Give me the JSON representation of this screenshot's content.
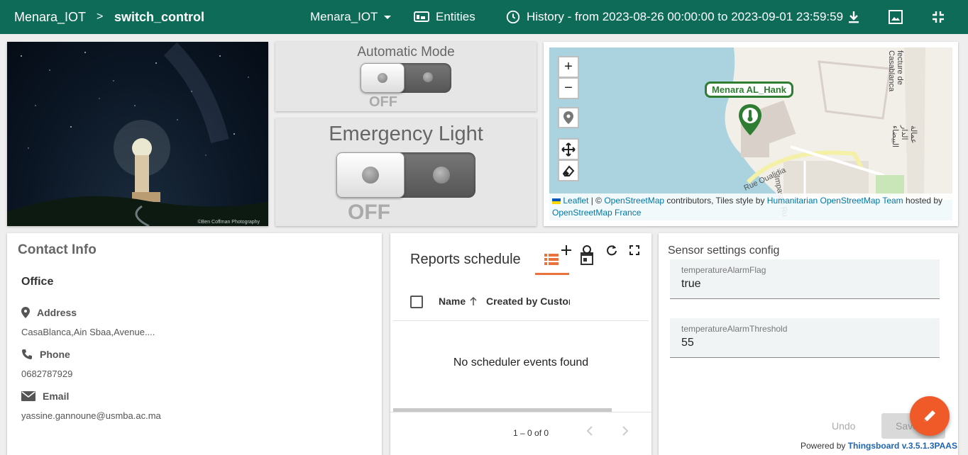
{
  "header": {
    "breadcrumb_root": "Menara_IOT",
    "breadcrumb_sep": ">",
    "breadcrumb_current": "switch_control",
    "entity_selector": "Menara_IOT",
    "entities_label": "Entities",
    "history_label": "History - from 2023-08-26 00:00:00 to 2023-09-01 23:59:59",
    "icons": [
      "dashboard-icon",
      "clock-icon",
      "download-icon",
      "image-export-icon",
      "exit-fullscreen-icon"
    ]
  },
  "photo": {
    "credit": "©Ben Coffman Photography"
  },
  "auto_mode": {
    "title": "Automatic Mode",
    "state": "OFF"
  },
  "emergency": {
    "title": "Emergency Light",
    "state": "OFF"
  },
  "map": {
    "zoom_in": "+",
    "zoom_out": "−",
    "marker_label": "Menara AL_Hank",
    "street_1": "Rue Oualidia",
    "street_2": "Impasse Ru",
    "street_3": "fecture de Casablanca",
    "street_4": "عمالة الدار البيضاء",
    "attribution": {
      "leaflet": "Leaflet",
      "sep": " | © ",
      "osm": "OpenStreetMap",
      "contrib": " contributors, Tiles style by ",
      "hot": "Humanitarian OpenStreetMap Team",
      "hosted": " hosted by",
      "osmfr": "OpenStreetMap France"
    }
  },
  "contact": {
    "title": "Contact Info",
    "subtitle": "Office",
    "address_label": "Address",
    "address_value": "CasaBlanca,Ain Sbaa,Avenue....",
    "phone_label": "Phone",
    "phone_value": "0682787929",
    "email_label": "Email",
    "email_value": "yassine.gannoune@usmba.ac.ma"
  },
  "reports": {
    "title": "Reports schedule",
    "col_name": "Name",
    "col_created": "Created by Custom",
    "empty_text": "No scheduler events found",
    "pager_text": "1 – 0 of 0"
  },
  "sensor": {
    "title": "Sensor settings config",
    "field1_label": "temperatureAlarmFlag",
    "field1_value": "true",
    "field2_label": "temperatureAlarmThreshold",
    "field2_value": "55",
    "undo_label": "Undo",
    "save_label": "Save"
  },
  "footer": {
    "powered_prefix": "Powered by ",
    "brand": "Thingsboard v.3.5.1.3PAAS"
  },
  "colors": {
    "header": "#0d6b58",
    "accent": "#f05a28",
    "tab_underline": "#e8733d",
    "marker": "#2e7d32"
  }
}
